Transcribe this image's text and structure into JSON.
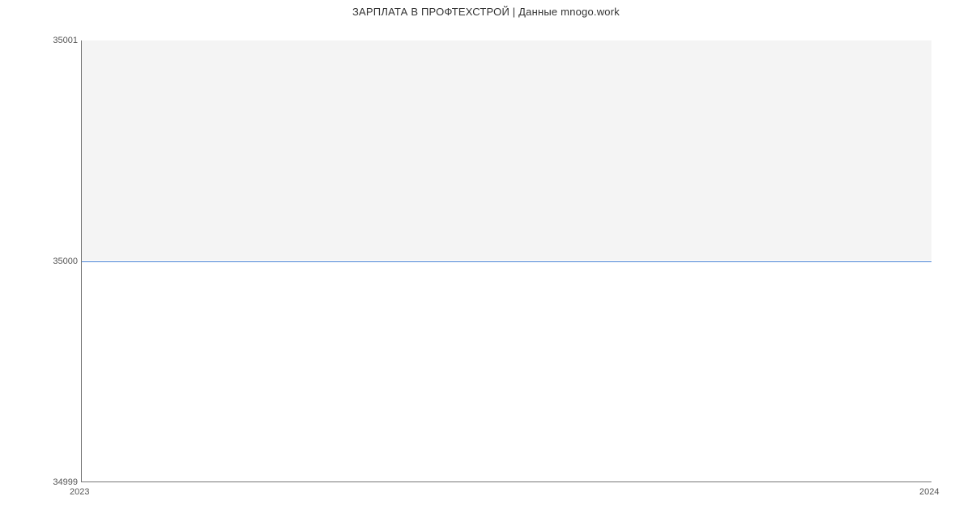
{
  "chart_data": {
    "type": "line",
    "title": "ЗАРПЛАТА В  ПРОФТЕХСТРОЙ | Данные mnogo.work",
    "xlabel": "",
    "ylabel": "",
    "x": [
      "2023",
      "2024"
    ],
    "values": [
      35000,
      35000
    ],
    "xlim": [
      "2023",
      "2024"
    ],
    "ylim": [
      34999,
      35001
    ],
    "y_ticks": [
      34999,
      35000,
      35001
    ],
    "x_ticks": [
      "2023",
      "2024"
    ],
    "line_color": "#4a84d6",
    "plot_bg": "#f4f4f4"
  }
}
